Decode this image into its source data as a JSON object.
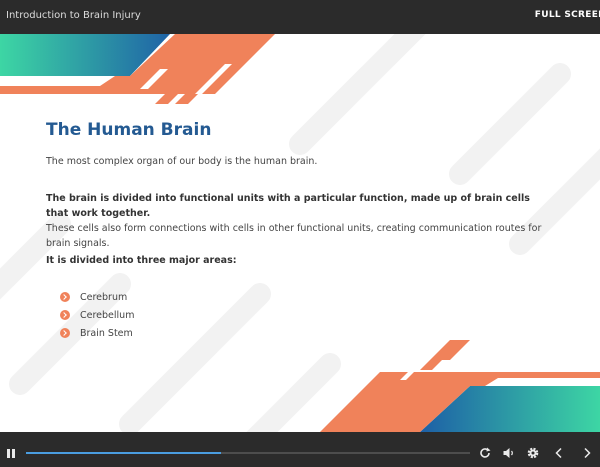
{
  "header": {
    "title": "Introduction to Brain Injury",
    "fullscreen_label": "FULL SCREEN"
  },
  "slide": {
    "heading": "The Human Brain",
    "intro": "The most complex organ of our body is the human brain.",
    "bold_sentence": "The brain is divided into functional units with a particular function, made up of brain cells that work together.",
    "detail": "These cells also form connections with cells in other functional units, creating communication routes for brain signals.",
    "areas_heading": "It is divided into three major areas:",
    "areas": [
      "Cerebrum",
      "Cerebellum",
      "Brain Stem"
    ]
  },
  "player": {
    "progress_fraction": 0.44
  },
  "colors": {
    "accent_orange": "#f0825a",
    "heading_blue": "#245a92",
    "teal": "#3dd0a6",
    "progress_blue": "#4a9de0",
    "bar_bg": "#2b2b2b"
  },
  "icons": [
    "pause-icon",
    "replay-icon",
    "volume-icon",
    "settings-icon",
    "previous-icon",
    "next-icon",
    "bullet-chevron-icon"
  ]
}
